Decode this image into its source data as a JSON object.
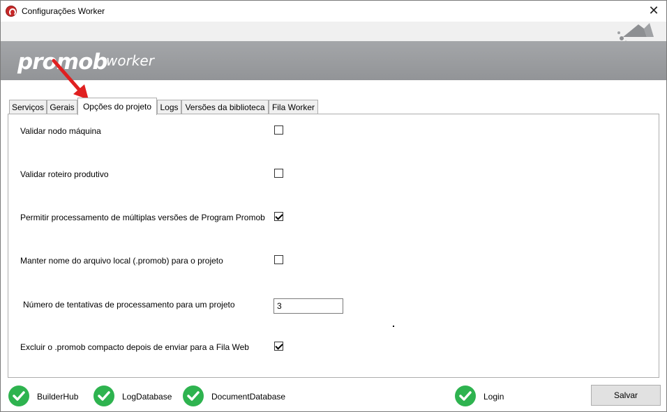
{
  "window": {
    "title": "Configurações Worker",
    "close_glyph": "✕"
  },
  "banner": {
    "logo": "promob",
    "subtitle": "worker"
  },
  "tabs": [
    {
      "label": "Serviços",
      "active": false
    },
    {
      "label": "Gerais",
      "active": false
    },
    {
      "label": "Opções do projeto",
      "active": true
    },
    {
      "label": "Logs",
      "active": false
    },
    {
      "label": "Versões da biblioteca",
      "active": false
    },
    {
      "label": "Fila Worker",
      "active": false
    }
  ],
  "options": [
    {
      "label": "Validar nodo máquina",
      "checked": false
    },
    {
      "label": "Validar roteiro produtivo",
      "checked": false
    },
    {
      "label": "Permitir processamento de múltiplas versões de Program Promob",
      "checked": true
    },
    {
      "label": "Manter nome do arquivo local (.promob) para o projeto",
      "checked": false
    },
    {
      "label": "Número de tentativas de processamento para um projeto",
      "value": "3"
    },
    {
      "label": "Excluir o .promob compacto depois de enviar para a Fila Web",
      "checked": true
    }
  ],
  "status_items": [
    {
      "label": "BuilderHub",
      "icon": "check-circle-icon",
      "ok": true
    },
    {
      "label": "LogDatabase",
      "icon": "check-circle-icon",
      "ok": true
    },
    {
      "label": "DocumentDatabase",
      "icon": "check-circle-icon",
      "ok": true
    },
    {
      "label": "Login",
      "icon": "check-circle-icon",
      "ok": true
    }
  ],
  "save_label": "Salvar",
  "colors": {
    "status_green": "#2eb34f",
    "banner_gray": "#9c9ea1",
    "annotation_red": "#e02020"
  }
}
